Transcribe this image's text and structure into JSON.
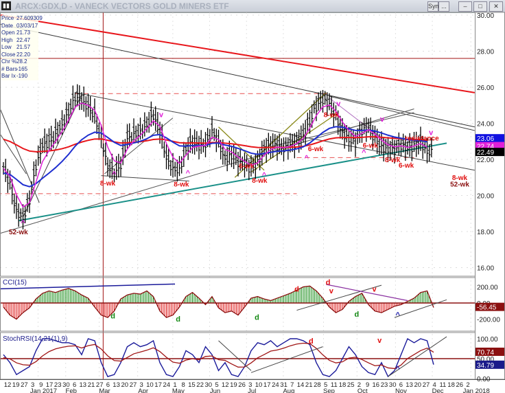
{
  "window": {
    "title": "ARCX:GDX,D - VANECK VECTORS GOLD MINERS ETF",
    "sym_button": "Sym",
    "sym_button2": "...",
    "min_icon": "minimize-icon",
    "max_icon": "maximize-icon",
    "close_icon": "close-icon"
  },
  "info": [
    {
      "label": "Price",
      "value": "27.609309"
    },
    {
      "label": "Date",
      "value": "03/03/17"
    },
    {
      "label": "Open",
      "value": "21.73"
    },
    {
      "label": "High",
      "value": "22.47"
    },
    {
      "label": "Low",
      "value": "21.57"
    },
    {
      "label": "Close",
      "value": "22.20"
    },
    {
      "label": "Chr %",
      "value": "28.2"
    },
    {
      "label": "# Bars",
      "value": "-165"
    },
    {
      "label": "Bar Ix",
      "value": "-190"
    }
  ],
  "chart_data": {
    "type": "line",
    "colors": {
      "red_ma": "#e8161b",
      "blue_ma": "#1f2fd0",
      "magenta_ma": "#e020d8",
      "teal": "#1a9088",
      "olive": "#8a8a1a",
      "hline": "#a01010",
      "cci_pos": "#118811",
      "cci_neg": "#dd1111",
      "cci_line": "#8b1010",
      "stoch_k": "#1a1a9a",
      "stoch_d": "#a01515"
    },
    "price": {
      "closes": [
        21.5,
        20.7,
        19.2,
        18.8,
        19.8,
        21.7,
        22.8,
        23.0,
        23.4,
        24.0,
        24.7,
        25.5,
        25.3,
        24.9,
        24.5,
        23.2,
        21.7,
        21.3,
        21.7,
        23.2,
        23.4,
        23.6,
        24.0,
        24.5,
        23.6,
        22.1,
        21.5,
        21.5,
        22.6,
        23.0,
        22.8,
        22.8,
        23.6,
        23.0,
        22.1,
        22.3,
        21.9,
        21.7,
        21.5,
        21.9,
        22.6,
        22.8,
        22.8,
        22.6,
        22.8,
        23.0,
        23.4,
        24.2,
        25.0,
        25.3,
        25.1,
        24.4,
        23.6,
        23.2,
        23.0,
        23.6,
        23.8,
        23.2,
        22.8,
        22.6,
        22.6,
        22.8,
        22.6,
        22.8,
        23.0,
        22.5
      ],
      "axis_ticks": [
        "30.00",
        "28.00",
        "26.00",
        "24.00",
        "22.00",
        "20.00",
        "18.00",
        "16.00"
      ],
      "axis_values": [
        30,
        28,
        26,
        24,
        22,
        20,
        18,
        16
      ],
      "ylim": [
        15.5,
        30.2
      ],
      "badges": [
        {
          "text": "23.06",
          "value": 23.06,
          "bg": "#1010e0",
          "fg": "#ffffff"
        },
        {
          "text": "22.74",
          "value": 22.74,
          "bg": "#e020d8",
          "fg": "#ffffff"
        },
        {
          "text": "22.49",
          "value": 22.49,
          "bg": "#000000",
          "fg": "#ffffff"
        }
      ],
      "hlines": [
        {
          "price": 27.6,
          "from": -1,
          "to": 73,
          "style": "solid",
          "color": "#a01010"
        },
        {
          "price": 25.65,
          "from": 11,
          "to": 50,
          "style": "dash",
          "color": "#e85050"
        },
        {
          "price": 20.1,
          "from": -1,
          "to": 45,
          "style": "dash",
          "color": "#e85050"
        },
        {
          "price": 22.1,
          "from": 45,
          "to": 63,
          "style": "dash",
          "color": "#e85050"
        }
      ],
      "vline_bar": 15.3,
      "trendlines": [
        {
          "p": [
            [
              -0.5,
              30.0
            ],
            [
              72.3,
              25.7
            ]
          ],
          "color": "#e8161b",
          "w": 2
        },
        {
          "p": [
            [
              -0.5,
              29.5
            ],
            [
              72.3,
              23.8
            ]
          ],
          "color": "#333333",
          "w": 1
        },
        {
          "p": [
            [
              11,
              25.7
            ],
            [
              72.3,
              21.4
            ]
          ],
          "color": "#444444",
          "w": 1
        },
        {
          "p": [
            [
              50,
              25.5
            ],
            [
              72.3,
              23.6
            ]
          ],
          "color": "#444444",
          "w": 1
        },
        {
          "p": [
            [
              -0.5,
              17.9
            ],
            [
              63,
              24.8
            ]
          ],
          "color": "#555555",
          "w": 1
        },
        {
          "p": [
            [
              2.3,
              18.6
            ],
            [
              68,
              22.9
            ]
          ],
          "color": "#1a9088",
          "w": 2
        },
        {
          "p": [
            [
              -0.5,
              24.8
            ],
            [
              5.5,
              19.6
            ]
          ],
          "color": "#444444",
          "w": 1
        },
        {
          "p": [
            [
              -0.5,
              23.4
            ],
            [
              3.5,
              21.2
            ]
          ],
          "color": "#444444",
          "w": 1
        },
        {
          "p": [
            [
              3,
              18.8
            ],
            [
              12,
              25.6
            ]
          ],
          "color": "#444444",
          "w": 1
        },
        {
          "p": [
            [
              15.5,
              21.2
            ],
            [
              26,
              24.3
            ]
          ],
          "color": "#555555",
          "w": 1
        },
        {
          "p": [
            [
              15,
              21.1
            ],
            [
              28.5,
              20.8
            ]
          ],
          "color": "#444444",
          "w": 1
        },
        {
          "p": [
            [
              33,
              23.8
            ],
            [
              40,
              21.4
            ]
          ],
          "color": "#8a8a1a",
          "w": 1.3
        },
        {
          "p": [
            [
              35.5,
              21.0
            ],
            [
              49.5,
              25.7
            ]
          ],
          "color": "#8a8a1a",
          "w": 1.3
        },
        {
          "p": [
            [
              38,
              21.3
            ],
            [
              51,
              24.5
            ]
          ],
          "color": "#8a8a1a",
          "w": 1.3
        },
        {
          "p": [
            [
              50,
              25.4
            ],
            [
              60.5,
              22.5
            ]
          ],
          "color": "#b070c0",
          "w": 1
        },
        {
          "p": [
            [
              41,
              22.7
            ],
            [
              63,
              24.6
            ]
          ],
          "color": "#555555",
          "w": 1
        },
        {
          "p": [
            [
              59,
              22.8
            ],
            [
              66,
              23.1
            ]
          ],
          "color": "#555555",
          "w": 1
        }
      ],
      "labels": [
        {
          "text": "52-wk",
          "i": 2.3,
          "price": 17.85,
          "color": "#8b1010"
        },
        {
          "text": "^",
          "i": 3,
          "price": 18.35,
          "color": "#e020d8"
        },
        {
          "text": "8-wk",
          "i": 16,
          "price": 20.55,
          "color": "#e01010"
        },
        {
          "text": "^",
          "i": 17,
          "price": 21.05,
          "color": "#e020d8"
        },
        {
          "text": "8-wk",
          "i": 27.3,
          "price": 20.5,
          "color": "#e01010"
        },
        {
          "text": "^",
          "i": 28.3,
          "price": 21.1,
          "color": "#e020d8"
        },
        {
          "text": "v",
          "i": 24.2,
          "price": 24.35,
          "color": "#e020d8"
        },
        {
          "text": "6-wk",
          "i": 37.3,
          "price": 21.5,
          "color": "#e01010"
        },
        {
          "text": "8-wk",
          "i": 39.3,
          "price": 20.7,
          "color": "#e01010"
        },
        {
          "text": "^",
          "i": 40,
          "price": 21.0,
          "color": "#e020d8"
        },
        {
          "text": "6-wk",
          "i": 47.9,
          "price": 22.45,
          "color": "#e01010"
        },
        {
          "text": "^",
          "i": 46.5,
          "price": 21.95,
          "color": "#e020d8"
        },
        {
          "text": "8-wk",
          "i": 50.3,
          "price": 24.35,
          "color": "#e01010"
        },
        {
          "text": "v",
          "i": 51.4,
          "price": 24.95,
          "color": "#e020d8"
        },
        {
          "text": "v",
          "i": 58.1,
          "price": 24.1,
          "color": "#e020d8"
        },
        {
          "text": "6-wk",
          "i": 56.3,
          "price": 22.65,
          "color": "#e01010"
        },
        {
          "text": "^",
          "i": 55.3,
          "price": 22.25,
          "color": "#e020d8"
        },
        {
          "text": "8-wk",
          "i": 59.7,
          "price": 21.85,
          "color": "#e01010"
        },
        {
          "text": "6-wk",
          "i": 61.8,
          "price": 21.55,
          "color": "#e01010"
        },
        {
          "text": "resistance",
          "i": 64.2,
          "price": 23.05,
          "color": "#e01010"
        },
        {
          "text": "v",
          "i": 65.6,
          "price": 23.35,
          "color": "#e020d8"
        },
        {
          "text": "8-wk",
          "i": 70,
          "price": 20.85,
          "color": "#e01010"
        },
        {
          "text": "52-wk",
          "i": 70,
          "price": 20.5,
          "color": "#8b1010"
        }
      ]
    },
    "cci": {
      "title": "CCI(15)",
      "values": [
        -50,
        -150,
        -200,
        -120,
        -60,
        50,
        120,
        150,
        130,
        160,
        180,
        150,
        100,
        60,
        -50,
        -150,
        -180,
        -100,
        50,
        100,
        120,
        110,
        150,
        80,
        -100,
        -180,
        -150,
        -50,
        80,
        130,
        60,
        -20,
        80,
        -60,
        -120,
        -100,
        -150,
        -50,
        60,
        80,
        50,
        30,
        60,
        90,
        120,
        160,
        200,
        210,
        150,
        60,
        -50,
        -120,
        -80,
        20,
        80,
        120,
        -20,
        -100,
        -120,
        -80,
        -40,
        -20,
        20,
        60,
        130,
        150,
        -56
      ],
      "axis_ticks": [
        "200.00",
        "0.00",
        "-200.00"
      ],
      "axis_values": [
        200,
        0,
        -200
      ],
      "badge": {
        "text": "-56.45",
        "value": -56.45,
        "bg": "#8b1010",
        "fg": "#ffffff"
      },
      "labels": [
        {
          "text": "d",
          "i": 16.8,
          "value": -190,
          "color": "#118811"
        },
        {
          "text": "d",
          "i": 26.8,
          "value": -230,
          "color": "#118811"
        },
        {
          "text": "d",
          "i": 38.9,
          "value": -210,
          "color": "#118811"
        },
        {
          "text": "d",
          "i": 54.2,
          "value": -170,
          "color": "#118811"
        },
        {
          "text": "d",
          "i": 45,
          "value": 140,
          "color": "#e01010"
        },
        {
          "text": "d",
          "i": 49.8,
          "value": 225,
          "color": "#e01010"
        },
        {
          "text": "v",
          "i": 50.3,
          "value": 120,
          "color": "#e01010"
        },
        {
          "text": "v",
          "i": 56.9,
          "value": 140,
          "color": "#e01010"
        },
        {
          "text": "^",
          "i": 60.5,
          "value": -180,
          "color": "#1a1aaa"
        }
      ]
    },
    "stoch": {
      "title": "StochRSI(14,21(1),9)",
      "values": [
        60,
        40,
        10,
        20,
        30,
        70,
        100,
        100,
        95,
        90,
        90,
        85,
        60,
        100,
        95,
        40,
        5,
        10,
        40,
        80,
        90,
        80,
        85,
        95,
        40,
        10,
        5,
        30,
        70,
        60,
        40,
        80,
        60,
        20,
        40,
        10,
        5,
        30,
        70,
        90,
        85,
        95,
        80,
        90,
        100,
        100,
        95,
        85,
        40,
        10,
        5,
        20,
        50,
        80,
        60,
        30,
        15,
        10,
        40,
        5,
        20,
        60,
        100,
        90,
        100,
        95,
        35
      ],
      "axis_ticks": [
        "100.00",
        "50.00",
        "0.00"
      ],
      "axis_values": [
        100,
        50,
        0
      ],
      "badges": [
        {
          "text": "70.74",
          "value": 70.74,
          "bg": "#8b1010",
          "fg": "#ffffff"
        },
        {
          "text": "34.79",
          "value": 34.79,
          "bg": "#1a1a8a",
          "fg": "#ffffff"
        }
      ],
      "labels": [
        {
          "text": "d",
          "i": 47.2,
          "value": 88,
          "color": "#e01010"
        },
        {
          "text": "v",
          "i": 57.7,
          "value": 90,
          "color": "#e01010"
        },
        {
          "text": "^",
          "i": 60.5,
          "value": 18,
          "color": "#1a1aaa"
        }
      ]
    },
    "x_axis": {
      "weeks": [
        "12",
        "19",
        "27",
        "3",
        "9",
        "17",
        "23",
        "30",
        "6",
        "13",
        "21",
        "27",
        "6",
        "13",
        "20",
        "27",
        "3",
        "10",
        "17",
        "24",
        "1",
        "8",
        "15",
        "22",
        "30",
        "5",
        "12",
        "19",
        "26",
        "3",
        "10",
        "17",
        "24",
        "31",
        "7",
        "14",
        "21",
        "28",
        "5",
        "11",
        "18",
        "25",
        "2",
        "9",
        "16",
        "23",
        "30",
        "6",
        "13",
        "20",
        "27",
        "4",
        "11",
        "18",
        "26",
        "2"
      ],
      "months": [
        {
          "label": "Jan 2017",
          "week": 4.3
        },
        {
          "label": "Feb",
          "week": 7.6
        },
        {
          "label": "Mar",
          "week": 11.6
        },
        {
          "label": "Apr",
          "week": 16.2
        },
        {
          "label": "May",
          "week": 20.4
        },
        {
          "label": "Jun",
          "week": 24.8
        },
        {
          "label": "Jul",
          "week": 29.2
        },
        {
          "label": "Aug",
          "week": 33.6
        },
        {
          "label": "Sep",
          "week": 38.4
        },
        {
          "label": "Oct",
          "week": 42.4
        },
        {
          "label": "Nov",
          "week": 47.0
        },
        {
          "label": "Dec",
          "week": 51.4
        },
        {
          "label": "Jan 2018",
          "week": 56.0
        }
      ]
    }
  }
}
